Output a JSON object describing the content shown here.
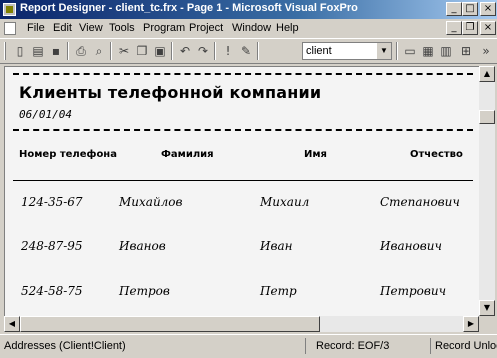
{
  "window": {
    "title": "Report Designer - client_tc.frx - Page 1 - Microsoft Visual FoxPro",
    "buttons": {
      "minimize": "_",
      "maximize": "□",
      "close": "×"
    }
  },
  "menu": {
    "items": [
      "File",
      "Edit",
      "View",
      "Tools",
      "Program",
      "Project",
      "Window",
      "Help"
    ],
    "mdi_buttons": {
      "minimize": "_",
      "restore": "❐",
      "close": "×"
    }
  },
  "toolbar": {
    "icons": [
      "new-icon",
      "open-icon",
      "save-icon",
      "print-icon",
      "print-preview-icon",
      "cut-icon",
      "copy-icon",
      "paste-icon",
      "undo-icon",
      "redo-icon",
      "run-icon",
      "modify-form-icon",
      "form-icon",
      "report-icon",
      "label-icon",
      "zoom-icon"
    ],
    "combo_value": "client"
  },
  "report": {
    "title": "Клиенты телефонной компании",
    "date": "06/01/04",
    "headers": [
      "Номер телефона",
      "Фамилия",
      "Имя",
      "Отчество"
    ],
    "rows": [
      [
        "124-35-67",
        "Михайлов",
        "Михаил",
        "Степанович"
      ],
      [
        "248-87-95",
        "Иванов",
        "Иван",
        "Иванович"
      ],
      [
        "524-58-75",
        "Петров",
        "Петр",
        "Петрович"
      ]
    ]
  },
  "status": {
    "left": "Addresses (Client!Client)",
    "record": "Record: EOF/3",
    "lock": "Record Unlock"
  }
}
